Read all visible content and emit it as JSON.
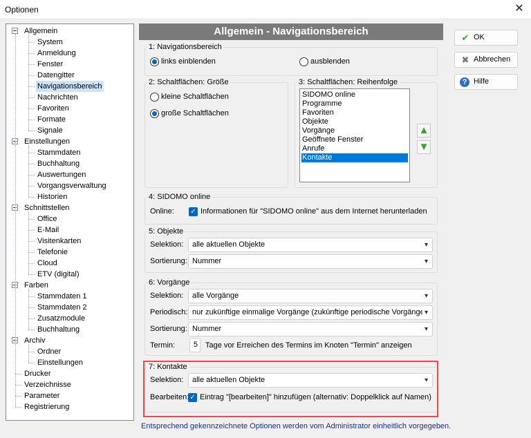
{
  "window": {
    "title": "Optionen",
    "close": "✕"
  },
  "tree": {
    "items": [
      {
        "label": "Allgemein",
        "level": 0,
        "expanded": true
      },
      {
        "label": "System",
        "level": 1
      },
      {
        "label": "Anmeldung",
        "level": 1
      },
      {
        "label": "Fenster",
        "level": 1
      },
      {
        "label": "Datengitter",
        "level": 1
      },
      {
        "label": "Navigationsbereich",
        "level": 1,
        "selected": true
      },
      {
        "label": "Nachrichten",
        "level": 1
      },
      {
        "label": "Favoriten",
        "level": 1
      },
      {
        "label": "Formate",
        "level": 1
      },
      {
        "label": "Signale",
        "level": 1
      },
      {
        "label": "Einstellungen",
        "level": 0,
        "expanded": true
      },
      {
        "label": "Stammdaten",
        "level": 1
      },
      {
        "label": "Buchhaltung",
        "level": 1
      },
      {
        "label": "Auswertungen",
        "level": 1
      },
      {
        "label": "Vorgangsverwaltung",
        "level": 1
      },
      {
        "label": "Historien",
        "level": 1
      },
      {
        "label": "Schnittstellen",
        "level": 0,
        "expanded": true
      },
      {
        "label": "Office",
        "level": 1
      },
      {
        "label": "E-Mail",
        "level": 1
      },
      {
        "label": "Visitenkarten",
        "level": 1
      },
      {
        "label": "Telefonie",
        "level": 1
      },
      {
        "label": "Cloud",
        "level": 1
      },
      {
        "label": "ETV (digital)",
        "level": 1
      },
      {
        "label": "Farben",
        "level": 0,
        "expanded": true
      },
      {
        "label": "Stammdaten 1",
        "level": 1
      },
      {
        "label": "Stammdaten 2",
        "level": 1
      },
      {
        "label": "Zusatzmodule",
        "level": 1
      },
      {
        "label": "Buchhaltung",
        "level": 1
      },
      {
        "label": "Archiv",
        "level": 0,
        "expanded": true
      },
      {
        "label": "Ordner",
        "level": 1
      },
      {
        "label": "Einstellungen",
        "level": 1
      },
      {
        "label": "Drucker",
        "level": 0
      },
      {
        "label": "Verzeichnisse",
        "level": 0
      },
      {
        "label": "Parameter",
        "level": 0
      },
      {
        "label": "Registrierung",
        "level": 0
      }
    ]
  },
  "header": {
    "title": "Allgemein - Navigationsbereich"
  },
  "nav_group": {
    "label": "1: Navigationsbereich",
    "option_show": "links einblenden",
    "option_hide": "ausblenden",
    "selected": "links einblenden"
  },
  "size_group": {
    "label": "2: Schaltflächen: Größe",
    "option_small": "kleine Schaltflächen",
    "option_large": "große Schaltflächen",
    "selected": "große Schaltflächen"
  },
  "order_group": {
    "label": "3: Schaltflächen: Reihenfolge",
    "items": [
      "SIDOMO online",
      "Programme",
      "Favoriten",
      "Objekte",
      "Vorgänge",
      "Geöffnete Fenster",
      "Anrufe",
      "Kontakte"
    ],
    "selected": "Kontakte",
    "up_icon": "arrow-up-icon",
    "down_icon": "arrow-down-icon"
  },
  "sidomo_group": {
    "label": "4: SIDOMO online",
    "field_label": "Online:",
    "checkbox_label": "Informationen für \"SIDOMO online\" aus dem Internet herunterladen",
    "checked": true
  },
  "objects_group": {
    "label": "5: Objekte",
    "selection_label": "Selektion:",
    "selection_value": "alle aktuellen Objekte",
    "sort_label": "Sortierung:",
    "sort_value": "Nummer"
  },
  "processes_group": {
    "label": "6: Vorgänge",
    "selection_label": "Selektion:",
    "selection_value": "alle Vorgänge",
    "periodic_label": "Periodisch:",
    "periodic_value": "nur zukünftige einmalige Vorgänge (zukünftige periodische Vorgänge i",
    "sort_label": "Sortierung:",
    "sort_value": "Nummer",
    "date_label": "Termin:",
    "date_value": "5",
    "date_suffix": "Tage vor Erreichen des Termins im Knoten \"Termin\" anzeigen"
  },
  "contacts_group": {
    "label": "7: Kontakte",
    "selection_label": "Selektion:",
    "selection_value": "alle aktuellen Objekte",
    "edit_label": "Bearbeiten:",
    "edit_checkbox_label": "Eintrag \"[bearbeiten]\" hinzufügen (alternativ: Doppelklick auf Namen)",
    "checked": true
  },
  "buttons": {
    "ok": "OK",
    "cancel": "Abbrechen",
    "help": "Hilfe"
  },
  "footer": {
    "note": "Entsprechend gekennzeichnete Optionen werden vom Administrator einheitlich vorgegeben."
  },
  "colors": {
    "header_bg": "#7a7a7a",
    "selection": "#0078d7",
    "highlight": "#e84a4a",
    "footer_text": "#1a2f8a"
  }
}
